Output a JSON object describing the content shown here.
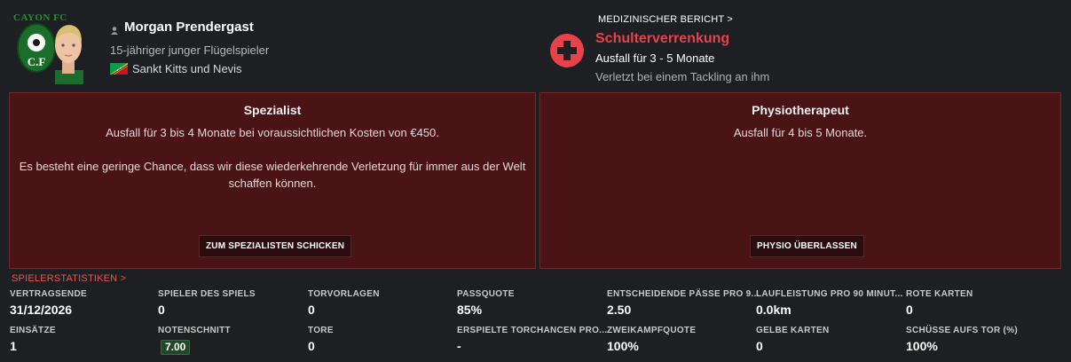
{
  "player": {
    "name": "Morgan Prendergast",
    "description": "15-jähriger junger Flügelspieler",
    "nationality": "Sankt Kitts und Nevis",
    "club_crest_text": "CAYON FC"
  },
  "injury": {
    "report_link": "MEDIZINISCHER BERICHT >",
    "title": "Schulterverrenkung",
    "duration": "Ausfall für 3 - 5 Monate",
    "cause": "Verletzt bei einem Tackling an ihm"
  },
  "panels": {
    "specialist": {
      "title": "Spezialist",
      "line1": "Ausfall für 3 bis 4 Monate bei voraussichtlichen Kosten von €450.",
      "line2": "Es besteht eine geringe Chance, dass wir diese wiederkehrende Verletzung für immer aus der Welt schaffen können.",
      "button": "ZUM SPEZIALISTEN SCHICKEN"
    },
    "physio": {
      "title": "Physiotherapeut",
      "line1": "Ausfall für 4 bis 5 Monate.",
      "button": "PHYSIO ÜBERLASSEN"
    }
  },
  "stats": {
    "link": "SPIELERSTATISTIKEN >",
    "row1": [
      {
        "label": "VERTRAGSENDE",
        "value": "31/12/2026"
      },
      {
        "label": "SPIELER DES SPIELS",
        "value": "0"
      },
      {
        "label": "TORVORLAGEN",
        "value": "0"
      },
      {
        "label": "PASSQUOTE",
        "value": "85%"
      },
      {
        "label": "ENTSCHEIDENDE PÄSSE PRO 9...",
        "value": "2.50"
      },
      {
        "label": "LAUFLEISTUNG PRO 90 MINUT...",
        "value": "0.0km"
      },
      {
        "label": "ROTE KARTEN",
        "value": "0"
      }
    ],
    "row2": [
      {
        "label": "EINSÄTZE",
        "value": "1"
      },
      {
        "label": "NOTENSCHNITT",
        "value": "7.00"
      },
      {
        "label": "TORE",
        "value": "0"
      },
      {
        "label": "ERSPIELTE TORCHANCEN PRO...",
        "value": "-"
      },
      {
        "label": "ZWEIKAMPFQUOTE",
        "value": "100%"
      },
      {
        "label": "GELBE KARTEN",
        "value": "0"
      },
      {
        "label": "SCHÜSSE AUFS TOR (%)",
        "value": "100%"
      }
    ]
  },
  "colors": {
    "background": "#1e1f22",
    "panel": "#4a1416",
    "injury_red": "#e8414a",
    "rating_green": "#1e4a25"
  }
}
